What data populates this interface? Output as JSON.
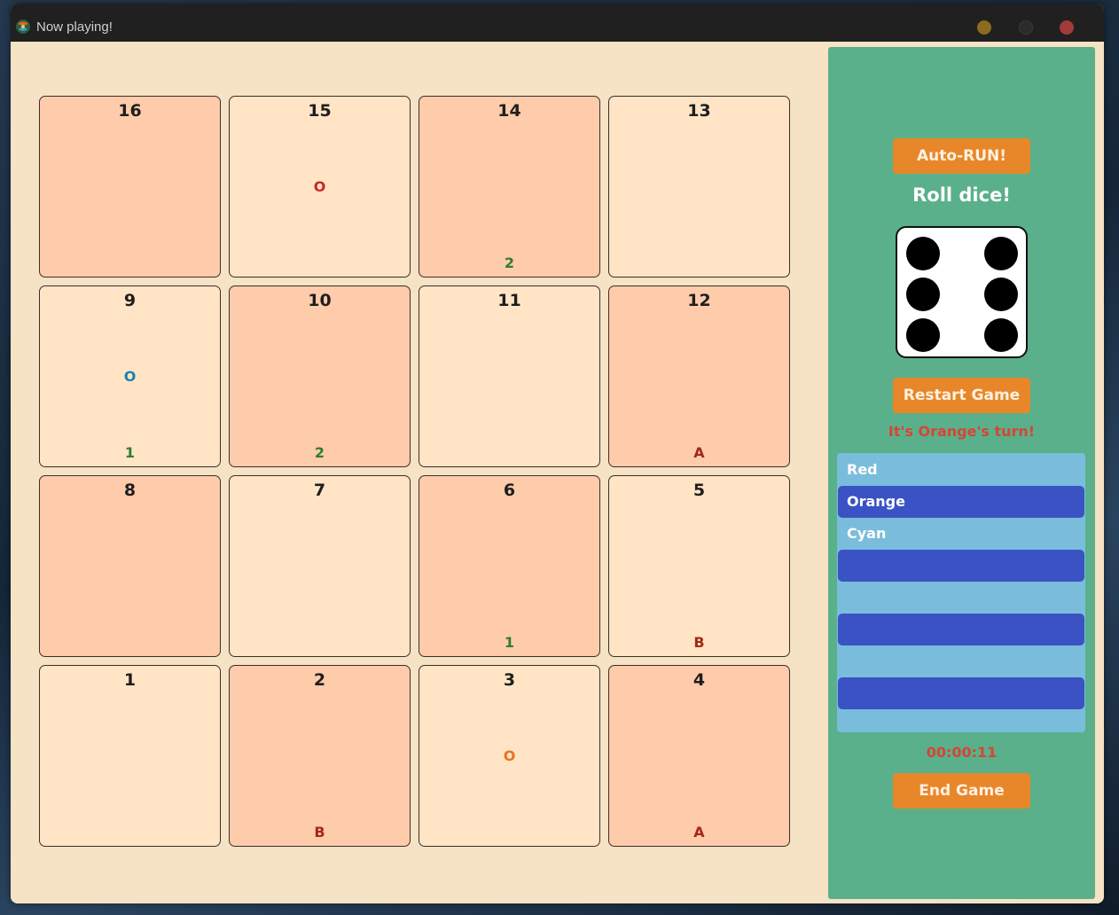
{
  "window": {
    "title": "Now playing!",
    "accent": "#202020"
  },
  "board": {
    "cells": [
      {
        "number": "16",
        "middle": "",
        "bottom": "",
        "tone": "peach"
      },
      {
        "number": "15",
        "middle": "O",
        "middle_color": "#c62828",
        "bottom": "",
        "tone": "cream"
      },
      {
        "number": "14",
        "middle": "",
        "bottom": "2",
        "bottom_color": "#2e7d32",
        "tone": "peach"
      },
      {
        "number": "13",
        "middle": "",
        "bottom": "",
        "tone": "cream"
      },
      {
        "number": "9",
        "middle": "O",
        "middle_color": "#1f7fb5",
        "bottom": "1",
        "bottom_color": "#2e7d32",
        "tone": "cream"
      },
      {
        "number": "10",
        "middle": "",
        "bottom": "2",
        "bottom_color": "#2e7d32",
        "tone": "peach"
      },
      {
        "number": "11",
        "middle": "",
        "bottom": "",
        "tone": "cream"
      },
      {
        "number": "12",
        "middle": "",
        "bottom": "A",
        "bottom_color": "#a12a16",
        "tone": "peach"
      },
      {
        "number": "8",
        "middle": "",
        "bottom": "",
        "tone": "peach"
      },
      {
        "number": "7",
        "middle": "",
        "bottom": "",
        "tone": "cream"
      },
      {
        "number": "6",
        "middle": "",
        "bottom": "1",
        "bottom_color": "#2e7d32",
        "tone": "peach"
      },
      {
        "number": "5",
        "middle": "",
        "bottom": "B",
        "bottom_color": "#a12a16",
        "tone": "cream"
      },
      {
        "number": "1",
        "middle": "",
        "bottom": "",
        "tone": "cream"
      },
      {
        "number": "2",
        "middle": "",
        "bottom": "B",
        "bottom_color": "#a12a16",
        "tone": "peach"
      },
      {
        "number": "3",
        "middle": "O",
        "middle_color": "#e8731f",
        "bottom": "",
        "tone": "cream"
      },
      {
        "number": "4",
        "middle": "",
        "bottom": "A",
        "bottom_color": "#a12a16",
        "tone": "peach"
      }
    ]
  },
  "panel": {
    "auto_run_label": "Auto-RUN!",
    "roll_label": "Roll dice!",
    "die_value": 6,
    "restart_label": "Restart Game",
    "turn_text": "It's Orange's turn!",
    "players": [
      {
        "name": "Red",
        "active": false
      },
      {
        "name": "Orange",
        "active": true
      },
      {
        "name": "Cyan",
        "active": false
      },
      {
        "name": "",
        "active": true
      },
      {
        "name": "",
        "active": false
      },
      {
        "name": "",
        "active": true
      },
      {
        "name": "",
        "active": false
      },
      {
        "name": "",
        "active": true
      }
    ],
    "timer": "00:00:11",
    "end_label": "End Game"
  },
  "colors": {
    "panel_bg": "#5ab08a",
    "button": "#e8872a",
    "player_list_bg": "#7abcdc",
    "player_active": "#3a52c4",
    "alert_text": "#d64536"
  }
}
